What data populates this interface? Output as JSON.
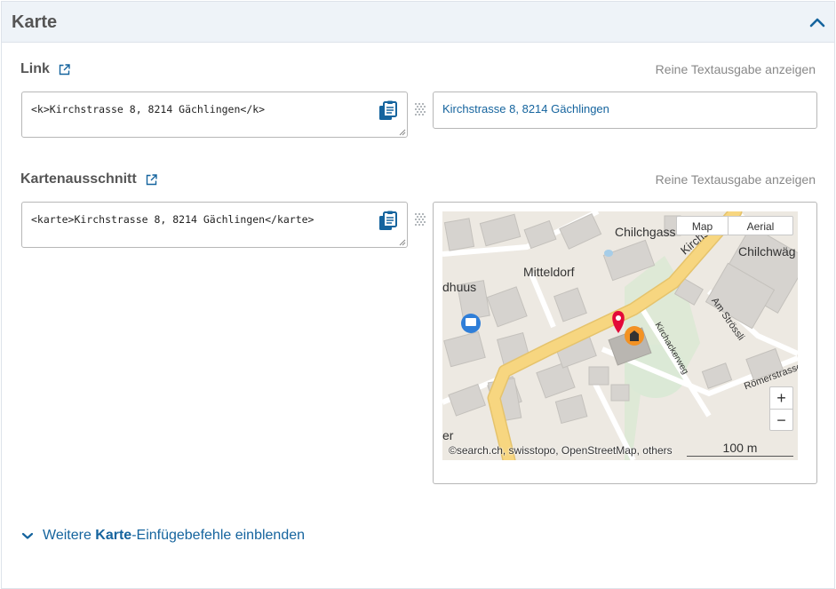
{
  "panel": {
    "title": "Karte"
  },
  "link_section": {
    "title": "Link",
    "plain_text_label": "Reine Textausgabe anzeigen",
    "code": "<k>Kirchstrasse 8, 8214 Gächlingen</k>",
    "preview_text": "Kirchstrasse 8, 8214 Gächlingen"
  },
  "map_section": {
    "title": "Kartenausschnitt",
    "plain_text_label": "Reine Textausgabe anzeigen",
    "code": "<karte>Kirchstrasse 8, 8214 Gächlingen</karte>"
  },
  "map": {
    "type_buttons": [
      "Map",
      "Aerial"
    ],
    "zoom_in": "+",
    "zoom_out": "−",
    "attribution": "©search.ch, swisstopo, OpenStreetMap, others",
    "scale": "100 m",
    "place_labels": [
      "Chilchgass",
      "Chilchwäg",
      "Mitteldorf",
      "dhuus",
      "Kirchstr",
      "Am Strössli",
      "Kirchackerweg",
      "Römerstrasse",
      "er"
    ],
    "colors": {
      "road": "#f7d680",
      "building": "#d6d3cf",
      "marker": "#e30a38",
      "poi": "#f39223",
      "green": "#d7e8d2"
    }
  },
  "footer": {
    "more_prefix": "Weitere ",
    "more_bold": "Karte",
    "more_suffix": "-Einfügebefehle einblenden"
  },
  "icons": {
    "collapse": "chevron-up-icon",
    "external": "external-link-icon",
    "copy": "clipboard-icon",
    "drag": "drag-handle-icon",
    "expand": "chevron-down-icon"
  }
}
